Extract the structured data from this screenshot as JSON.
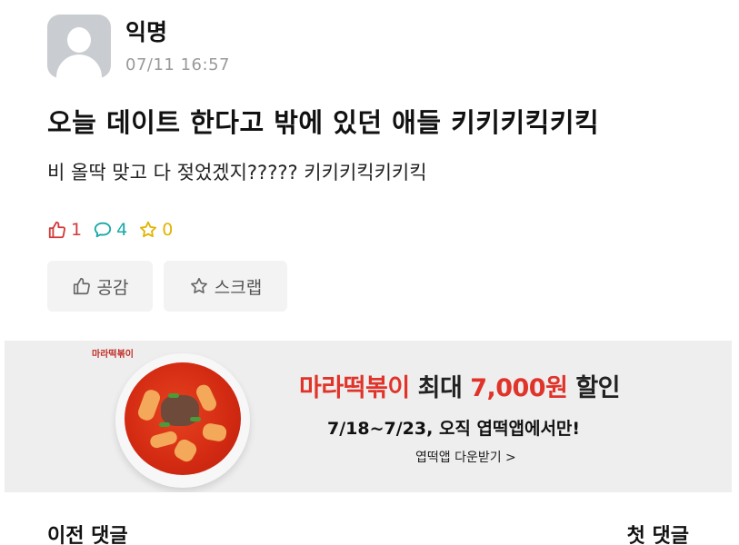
{
  "author": {
    "name": "익명",
    "time": "07/11 16:57"
  },
  "post": {
    "title": "오늘 데이트 한다고 밖에 있던 애들 키키키킥키킥",
    "body": "비 올딱 맞고 다 젖었겠지????? 키키키킥키키킥"
  },
  "stats": {
    "likes": "1",
    "comments": "4",
    "scraps": "0"
  },
  "actions": {
    "like_label": "공감",
    "scrap_label": "스크랩"
  },
  "ad": {
    "logo_text": "마라떡볶이",
    "title_part1": "마라떡볶이",
    "title_part2": " 최대 ",
    "title_part3": "7,000원",
    "title_part4": " 할인",
    "subtitle": "7/18~7/23, 오직 엽떡앱에서만!",
    "link": "엽떡앱 다운받기 >"
  },
  "comment_nav": {
    "prev": "이전 댓글",
    "first": "첫 댓글"
  },
  "colors": {
    "like": "#d23a3a",
    "comment": "#1aa8a8",
    "scrap": "#e0b400",
    "ad_accent": "#e0342a"
  }
}
